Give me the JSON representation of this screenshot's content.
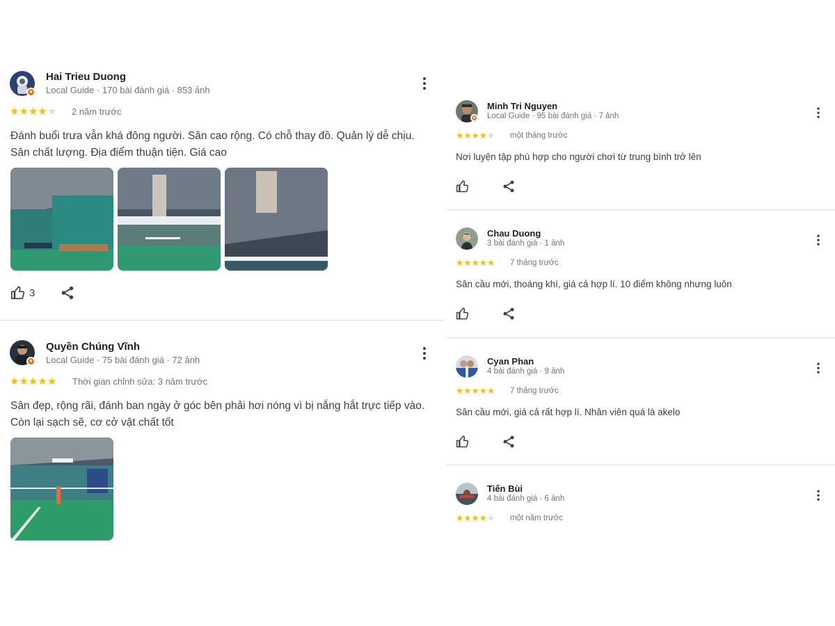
{
  "left_reviews": [
    {
      "name": "Hai Trieu Duong",
      "meta": "Local Guide · 170 bài đánh giá · 853 ảnh",
      "rating": 4,
      "time": "2 năm trước",
      "text": "Đánh buổi trưa vẫn khá đông người. Sân cao rộng. Có chỗ thay đồ. Quản lý dễ chịu. Sân chất lượng. Địa điểm thuận tiện. Giá cao",
      "likes": "3"
    },
    {
      "name": "Quyền Chúng Vĩnh",
      "meta": "Local Guide · 75 bài đánh giá · 72 ảnh",
      "rating": 5,
      "time": "Thời gian chỉnh sửa: 3 năm trước",
      "text": "Sân đẹp, rộng rãi, đánh ban ngày ở góc bên phải hơi nóng vì bị nắng hắt trực tiếp vào. Còn lại sạch sẽ, cơ cở vật chất tốt"
    }
  ],
  "right_reviews": [
    {
      "name": "Minh Tri Nguyen",
      "meta": "Local Guide · 95 bài đánh giá · 7 ảnh",
      "rating": 4,
      "time": "một tháng trước",
      "text": "Nơi luyện tập phù hợp cho người chơi từ trung bình trở lên"
    },
    {
      "name": "Chau Duong",
      "meta": "3 bài đánh giá · 1 ảnh",
      "rating": 5,
      "time": "7 tháng trước",
      "text": "Sân cầu mới, thoáng khí, giá cả hợp lí. 10 điểm không nhưng luôn"
    },
    {
      "name": "Cyan Phan",
      "meta": "4 bài đánh giá · 9 ảnh",
      "rating": 5,
      "time": "7 tháng trước",
      "text": "Sân cầu mới, giá cả rất hợp lí. Nhân viên quá là akelo"
    },
    {
      "name": "Tiến Bùi",
      "meta": "4 bài đánh giá · 6 ảnh",
      "rating": 4,
      "time": "một năm trước"
    }
  ],
  "icons": {
    "more": "more-vert-icon",
    "like": "thumb-up-icon",
    "share": "share-icon",
    "star": "star-icon",
    "guide_badge": "local-guide-badge-icon"
  },
  "colors": {
    "star_filled": "#fbbc04",
    "star_empty": "#dadce0",
    "badge": "#e8710a",
    "court_green": "#2e9c6a",
    "divider": "#dadce0"
  }
}
